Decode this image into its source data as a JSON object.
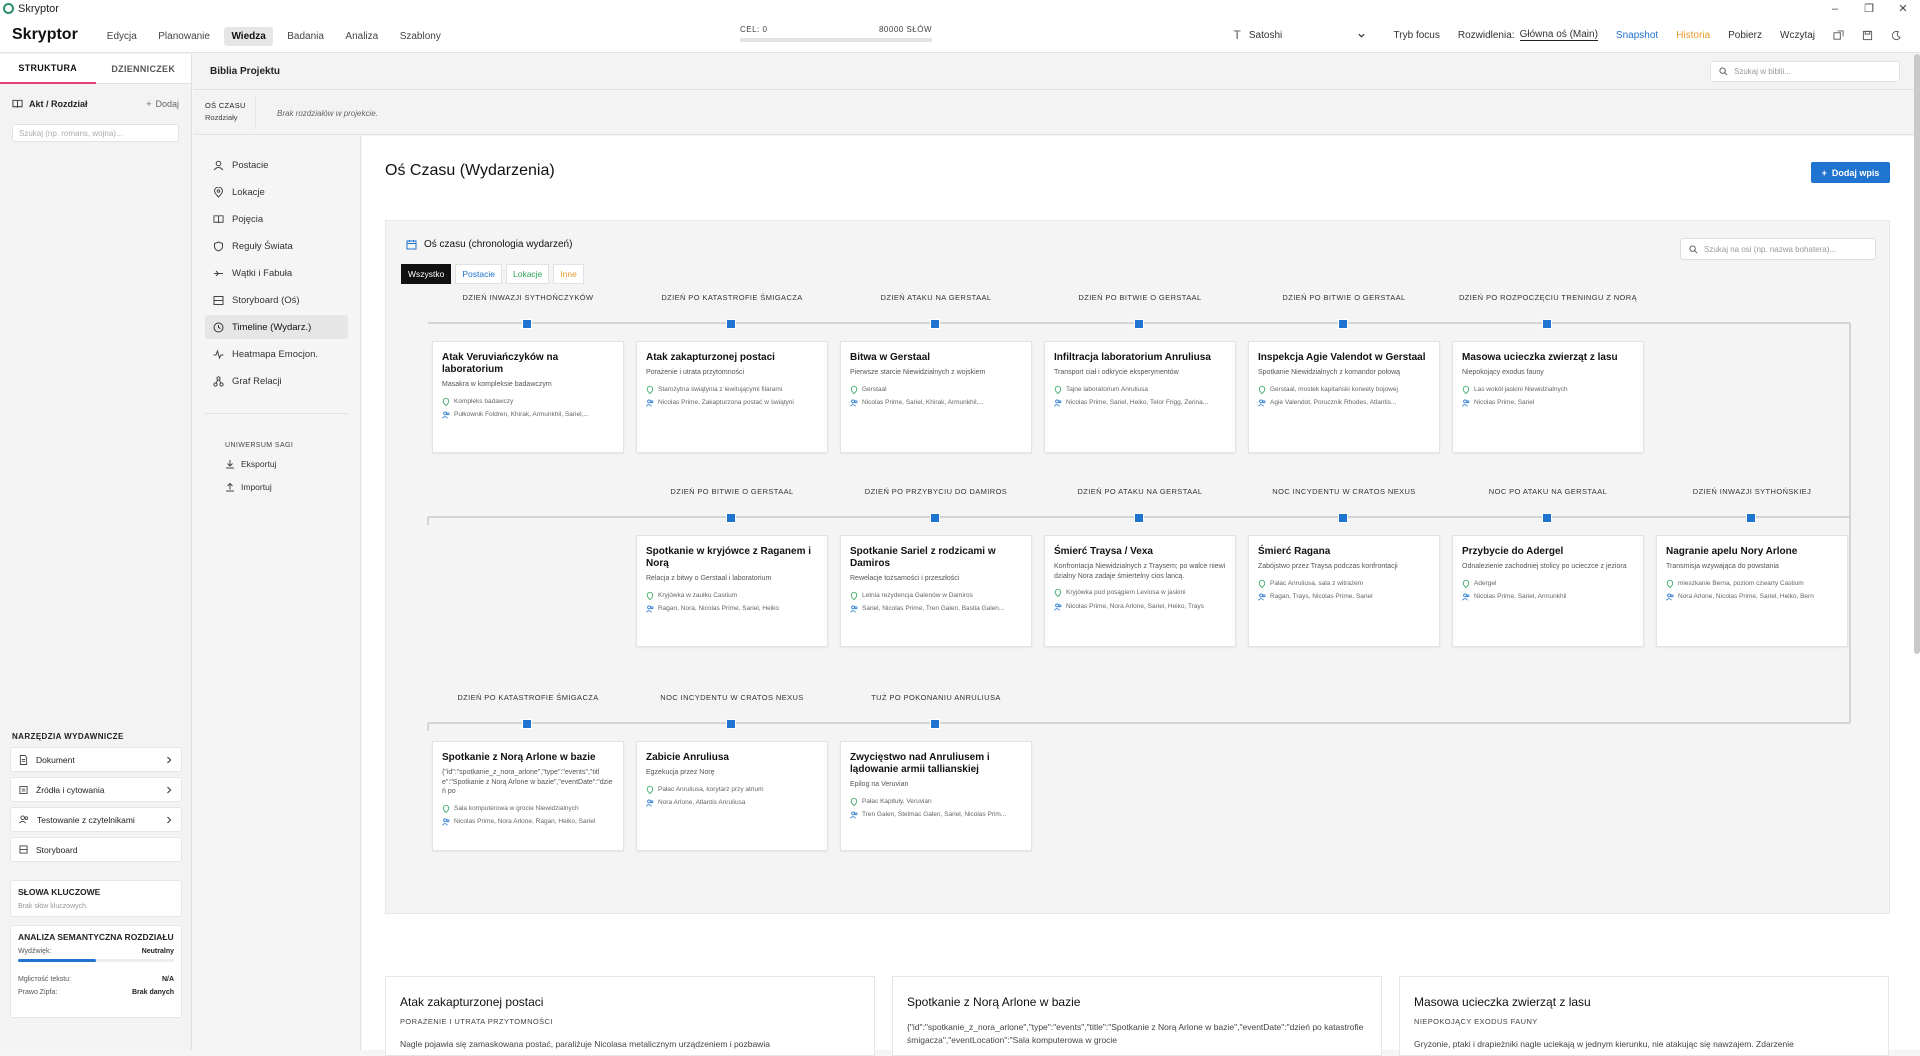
{
  "window": {
    "title": "Skryptor",
    "controls": [
      "–",
      "❐",
      "✕"
    ]
  },
  "brand": "Skryptor",
  "topnav": [
    {
      "label": "Edycja"
    },
    {
      "label": "Planowanie"
    },
    {
      "label": "Wiedza",
      "active": true
    },
    {
      "label": "Badania"
    },
    {
      "label": "Analiza"
    },
    {
      "label": "Szablony"
    }
  ],
  "goal": {
    "label": "CEL: 0",
    "target": "80000 SŁÓW",
    "progress": 0
  },
  "toolbar": {
    "font": "Satoshi",
    "focus": "Tryb focus",
    "branch_label": "Rozwidlenia:",
    "branch_value": "Główna oś (Main)",
    "snapshot": "Snapshot",
    "history": "Historia",
    "download": "Pobierz",
    "load": "Wczytaj"
  },
  "left": {
    "tabs": [
      {
        "label": "STRUKTURA",
        "active": true
      },
      {
        "label": "DZIENNICZEK"
      }
    ],
    "act_label": "Akt / Rozdział",
    "add_label": "Dodaj",
    "search_placeholder": "Szukaj (np. romans, wojna)...",
    "tools_title": "NARZĘDZIA WYDAWNICZE",
    "tools": [
      {
        "label": "Dokument",
        "icon": "document-icon"
      },
      {
        "label": "Źródła i cytowania",
        "icon": "link-icon"
      },
      {
        "label": "Testowanie z czytelnikami",
        "icon": "users-icon"
      },
      {
        "label": "Storyboard",
        "icon": "storyboard-icon"
      }
    ],
    "keywords_title": "SŁOWA KLUCZOWE",
    "keywords_empty": "Brak słów kluczowych.",
    "semantic": {
      "title": "ANALIZA SEMANTYCZNA ROZDZIAŁU",
      "tone_label": "Wydźwięk:",
      "tone_value": "Neutralny",
      "tone_level": 0.5,
      "fog_label": "Mgliстość tekstu:",
      "fog_value": "N/A",
      "zipf_label": "Prawo Zipfa:",
      "zipf_value": "Brak danych"
    }
  },
  "bible": {
    "title": "Biblia Projektu",
    "search_placeholder": "Szukaj w biblii..."
  },
  "timebar": {
    "label": "OŚ CZASU",
    "sub": "Rozdziały",
    "empty": "Brak rozdziałów w projekcie."
  },
  "secnav": {
    "items": [
      {
        "label": "Postacie",
        "icon": "users-icon"
      },
      {
        "label": "Lokacje",
        "icon": "map-pin-icon"
      },
      {
        "label": "Pojęcia",
        "icon": "book-icon"
      },
      {
        "label": "Reguły Świata",
        "icon": "shield-icon"
      },
      {
        "label": "Wątki i Fabuła",
        "icon": "thread-icon"
      },
      {
        "label": "Storyboard (Oś)",
        "icon": "storyboard-icon"
      },
      {
        "label": "Timeline (Wydarz.)",
        "icon": "clock-icon",
        "active": true
      },
      {
        "label": "Heatmapa Emocjon.",
        "icon": "pulse-icon"
      },
      {
        "label": "Graf Relacji",
        "icon": "graph-icon"
      }
    ],
    "universe_title": "UNIWERSUM SAGI",
    "export": "Eksportuj",
    "import": "Importuj"
  },
  "main": {
    "title": "Oś Czasu (Wydarzenia)",
    "add_button": "Dodaj wpis",
    "timeline_title": "Oś czasu (chronologia wydarzeń)",
    "filters": [
      {
        "label": "Wszystko",
        "color": "#ffffff",
        "active": true
      },
      {
        "label": "Postacie",
        "color": "#1f74d0"
      },
      {
        "label": "Lokacje",
        "color": "#2fa35a"
      },
      {
        "label": "Inne",
        "color": "#e89a2a"
      }
    ],
    "timeline_search": "Szukaj na osi (np. nazwa bohatera)..."
  },
  "rows": [
    {
      "events": [
        {
          "date": "DZIEŃ INWAZJI SYTHOŃCZYKÓW",
          "title": "Atak Veruviańczyków na laboratorium",
          "desc": "Masakra w kompleksie badawczym",
          "loc": "Kompleks badawczy",
          "people": "Pułkownik Foldren, Khirak, Armunkhil, Sariel,..."
        },
        {
          "date": "DZIEŃ PO KATASTROFIE ŚMIGACZA",
          "title": "Atak zakapturzonej postaci",
          "desc": "Porażenie i utrata przytomności",
          "loc": "Starożytna świątynia z lewitującymi filarami",
          "people": "Nicolas Prime, Zakapturzona postać w świątyni"
        },
        {
          "date": "DZIEŃ ATAKU NA GERSTAAL",
          "title": "Bitwa w Gerstaal",
          "desc": "Pierwsze starcie Niewidzialnych z wojskiem",
          "loc": "Gerstaal",
          "people": "Nicolas Prime, Sariel, Khirak, Armunkhil,..."
        },
        {
          "date": "DZIEŃ PO BITWIE O GERSTAAL",
          "title": "Infiltracja laboratorium Anruliusa",
          "desc": "Transport ciał i odkrycie eksperymentów",
          "loc": "Tajne laboratorium Anruliusa",
          "people": "Nicolas Prime, Sariel, Heiko, Telor Frigg, Zerina..."
        },
        {
          "date": "DZIEŃ PO BITWIE O GERSTAAL",
          "title": "Inspekcja Agie Valendot w Gerstaal",
          "desc": "Spotkanie Niewidzialnych z komandor polową",
          "loc": "Gerstaal, mostek kapitański korwety bojowej",
          "people": "Agie Valendot, Porucznik Rhodes, Atlantis..."
        },
        {
          "date": "DZIEŃ PO ROZPOCZĘCIU TRENINGU Z NORĄ",
          "title": "Masowa ucieczka zwierząt z lasu",
          "desc": "Niepokojący exodus fauny",
          "loc": "Las wokół jaskini Niewidzialnych",
          "people": "Nicolas Prime, Sariel"
        }
      ]
    },
    {
      "events": [
        {
          "date": "DZIEŃ PO BITWIE O GERSTAAL",
          "title": "Spotkanie w kryjówce z Raganem i Norą",
          "desc": "Relacja z bitwy o Gerstaal i laboratorium",
          "loc": "Kryjówka w zaułku Castium",
          "people": "Ragan, Nora, Nicolas Prime, Sariel, Heiko"
        },
        {
          "date": "DZIEŃ PO PRZYBYCIU DO DAMIROS",
          "title": "Spotkanie Sariel z rodzicami w Damiros",
          "desc": "Rewelacje tożsamości i przeszłości",
          "loc": "Letnia rezydencja Galenów w Damiros",
          "people": "Sariel, Nicolas Prime, Tren Galen, Bastia Galen..."
        },
        {
          "date": "DZIEŃ PO ATAKU NA GERSTAAL",
          "title": "Śmierć Traysa / Vexa",
          "desc": "Konfrontacja Niewidzialnych z Traysem; po walce niewidzialny Nora zadaje śmiertelny cios lancą.",
          "loc": "Kryjówka pod posągiem Leviosa w jaskini",
          "people": "Nicolas Prime, Nora Arlone, Sariel, Heiko, Trays"
        },
        {
          "date": "NOC INCYDENTU W CRATOS NEXUS",
          "title": "Śmierć Ragana",
          "desc": "Zabójstwo przez Traysa podczas konfrontacji",
          "loc": "Pałac Anruliusa, sala z witrażem",
          "people": "Ragan, Trays, Nicolas Prime, Sariel"
        },
        {
          "date": "NOC PO ATAKU NA GERSTAAL",
          "title": "Przybycie do Adergel",
          "desc": "Odnalezienie zachodniej stolicy po ucieczce z jeziora",
          "loc": "Adergel",
          "people": "Nicolas Prime, Sariel, Armunkhil"
        },
        {
          "date": "DZIEŃ INWAZJI SYTHOŃSKIEJ",
          "title": "Nagranie apelu Nory Arlone",
          "desc": "Transmisja wzywająca do powstania",
          "loc": "mieszkanie Berna, poziom czwarty Castium",
          "people": "Nora Arlone, Nicolas Prime, Sariel, Heiko, Bern"
        }
      ]
    },
    {
      "events": [
        {
          "date": "DZIEŃ PO KATASTROFIE ŚMIGACZA",
          "title": "Spotkanie z Norą Arlone w bazie",
          "desc": "{\"id\":\"spotkanie_z_nora_arlone\",\"type\":\"events\",\"title\":\"Spotkanie z Norą Arlone w bazie\",\"eventDate\":\"dzień po",
          "loc": "Sala komputerowa w grocie Niewidzialnych",
          "people": "Nicolas Prime, Nora Arlone, Ragan, Heiko, Sariel"
        },
        {
          "date": "NOC INCYDENTU W CRATOS NEXUS",
          "title": "Zabicie Anruliusa",
          "desc": "Egzekucja przez Norę",
          "loc": "Pałac Anruliusa, korytarz przy atrium",
          "people": "Nora Arlone, Atlantis Anruliusa"
        },
        {
          "date": "TUŻ PO POKONANIU ANRULIUSA",
          "title": "Zwycięstwo nad Anruliusem i lądowanie armii tallianskiej",
          "desc": "Epilog na Veruvian",
          "loc": "Pałac Kapituły, Veruvian",
          "people": "Tren Galen, Stelmac Galen, Sariel, Nicolas Prim..."
        }
      ]
    }
  ],
  "bottom_cards": [
    {
      "title": "Atak zakapturzonej postaci",
      "sub": "PORAŻENIE I UTRATA PRZYTOMNOŚCI",
      "desc": "Nagle pojawia się zamaskowana postać, paraliżuje Nicolasa metalicznym urządzeniem i pozbawia"
    },
    {
      "title": "Spotkanie z Norą Arlone w bazie",
      "sub": "",
      "desc": "{\"id\":\"spotkanie_z_nora_arlone\",\"type\":\"events\",\"title\":\"Spotkanie z Norą Arlone w bazie\",\"eventDate\":\"dzień po katastrofie śmigacza\",\"eventLocation\":\"Sala komputerowa w grocie"
    },
    {
      "title": "Masowa ucieczka zwierząt z lasu",
      "sub": "NIEPOKOJĄCY EXODUS FAUNY",
      "desc": "Gryzonie, ptaki i drapieżniki nagle uciekają w jednym kierunku, nie atakując się nawzajem. Zdarzenie"
    }
  ]
}
